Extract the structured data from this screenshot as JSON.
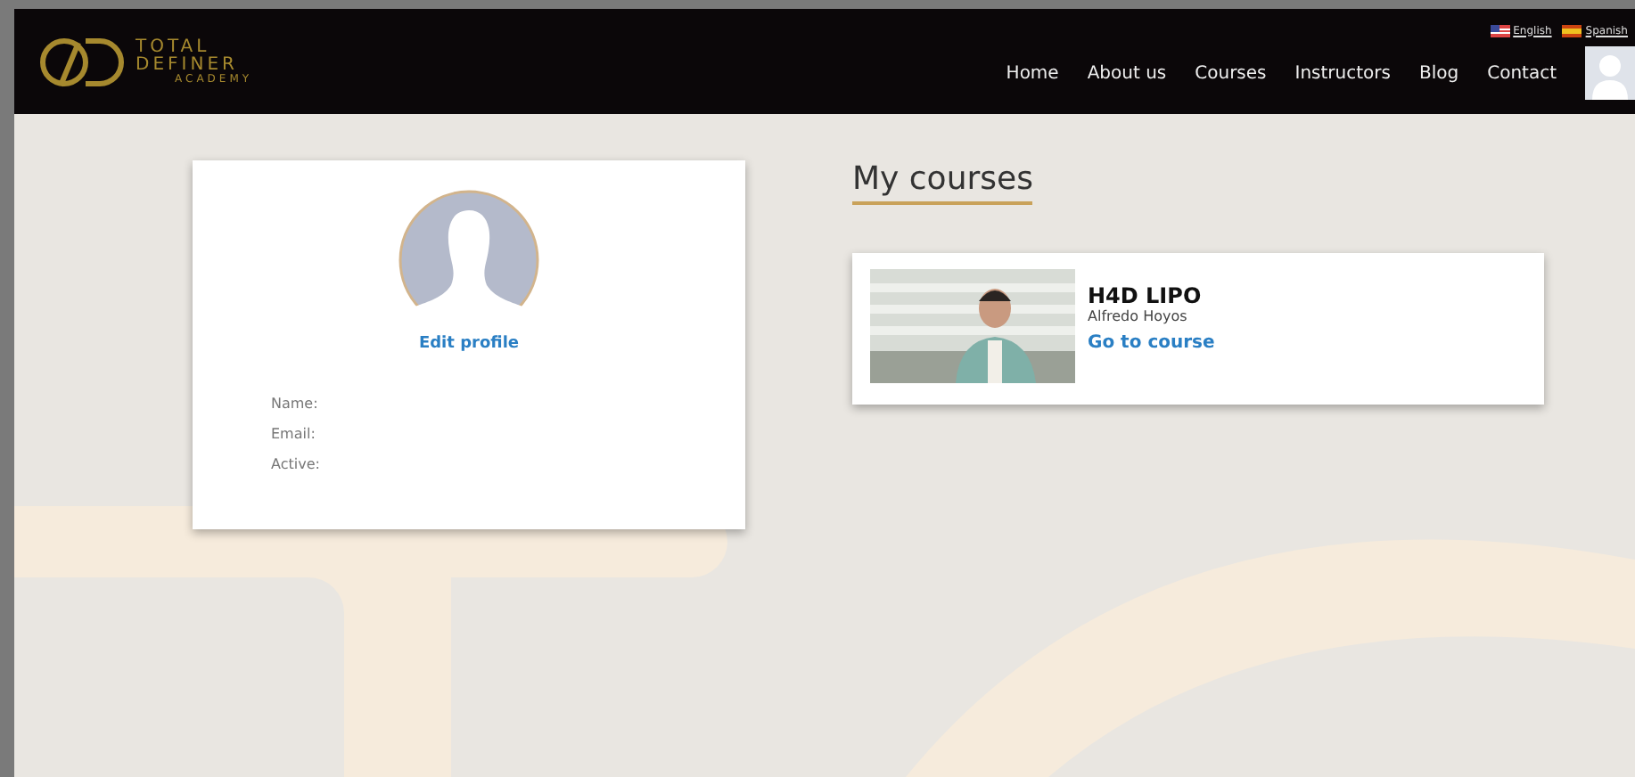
{
  "logo": {
    "lines": [
      "TOTAL",
      "DEFINER",
      "ACADEMY"
    ]
  },
  "languages": [
    {
      "label": "English",
      "kind": "us"
    },
    {
      "label": "Spanish",
      "kind": "es"
    }
  ],
  "nav": [
    "Home",
    "About us",
    "Courses",
    "Instructors",
    "Blog",
    "Contact"
  ],
  "profile": {
    "edit_link": "Edit profile",
    "fields": [
      "Name:",
      "Email:",
      "Active:"
    ]
  },
  "courses_title": "My courses",
  "courses": [
    {
      "title": "H4D LIPO",
      "instructor": "Alfredo Hoyos",
      "link": "Go to course"
    }
  ]
}
